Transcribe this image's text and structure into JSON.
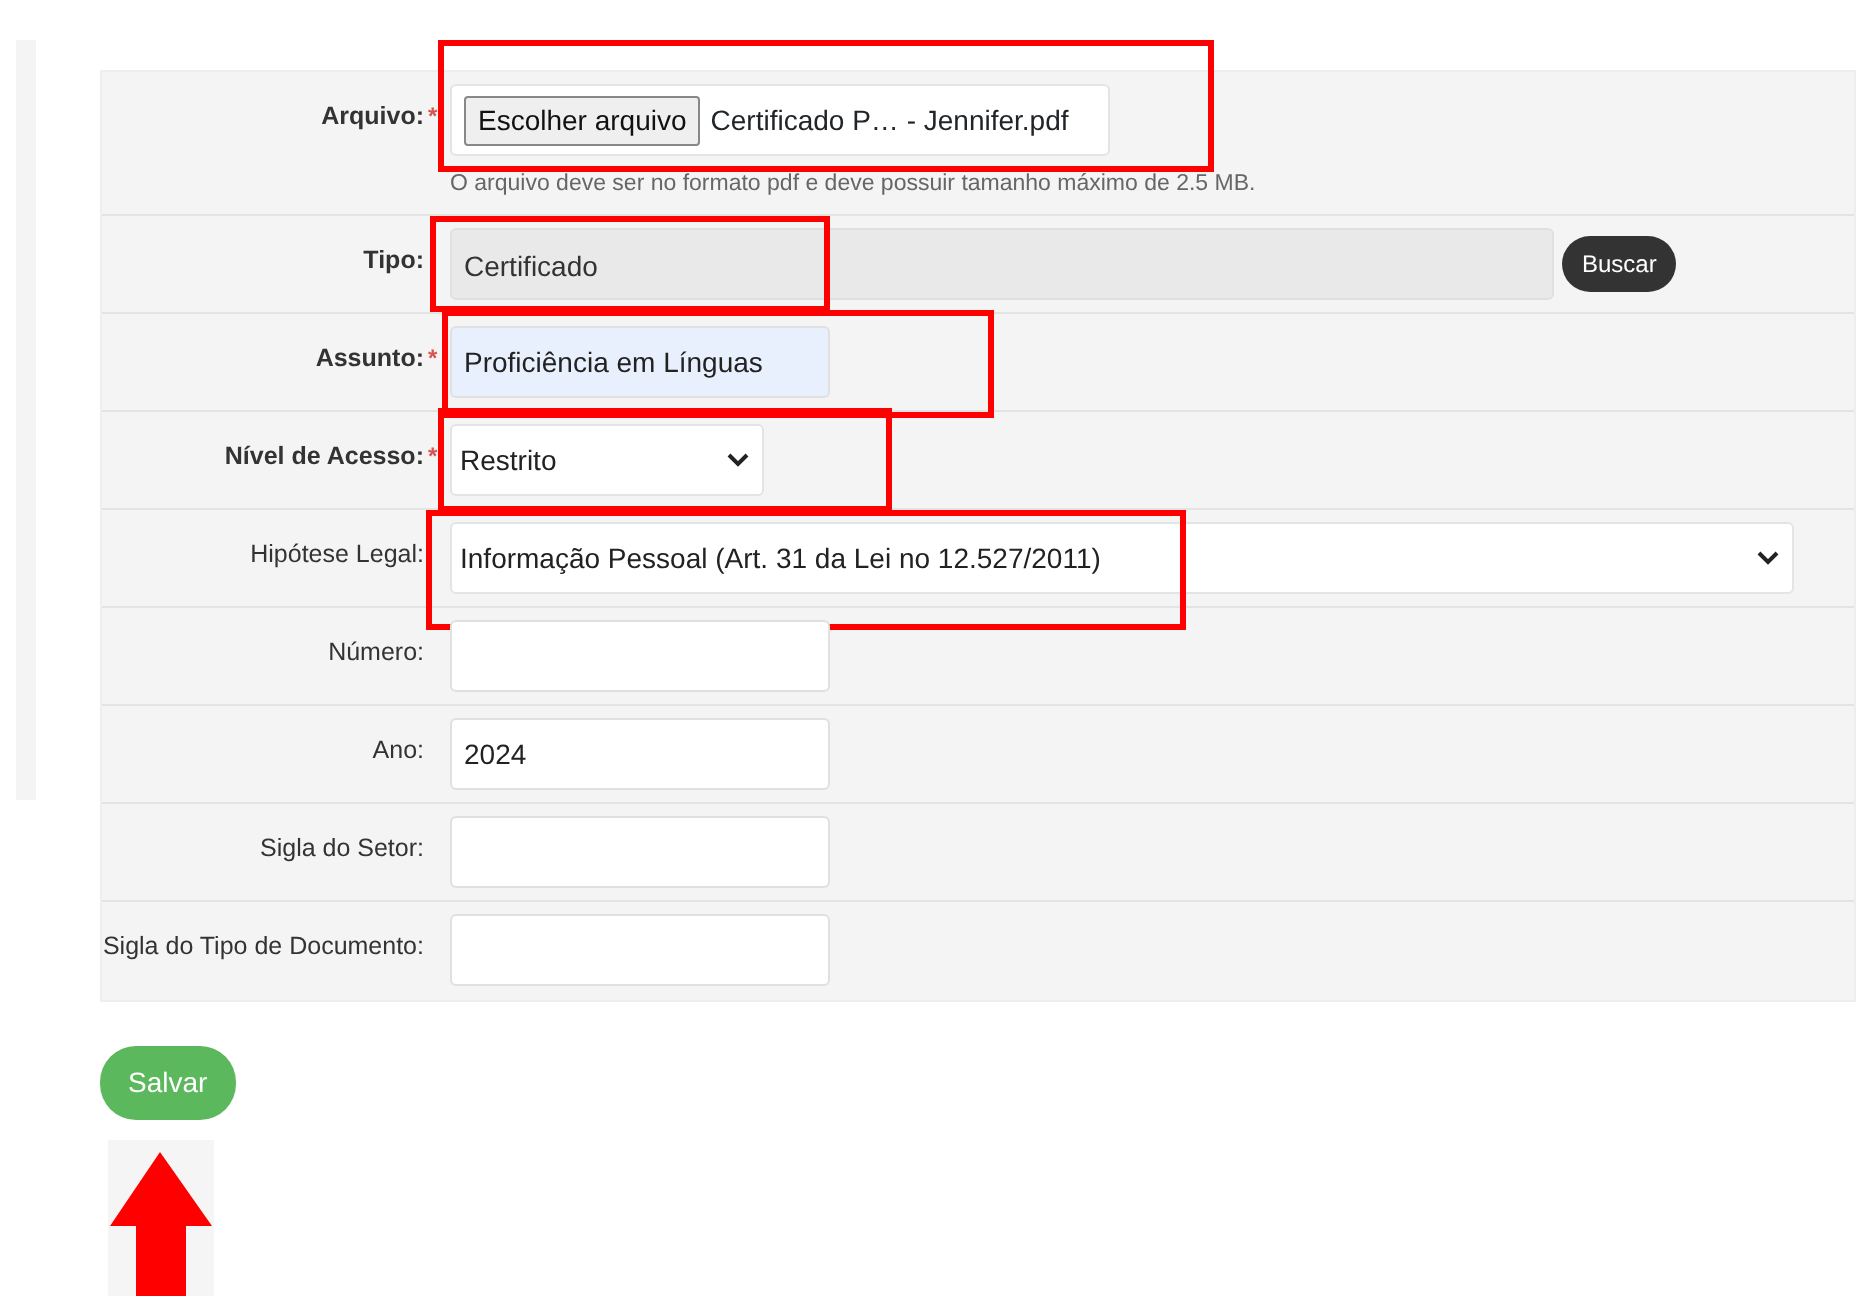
{
  "fields": [
    {
      "label": "Arquivo:",
      "kind": "file",
      "required_mark": "*",
      "bold": true,
      "annotated": true,
      "button": "Escolher arquivo",
      "value": "Certificado P… - Jennifer.pdf",
      "help": "O arquivo deve ser no formato pdf e deve possuir tamanho máximo de 2.5 MB."
    },
    {
      "label": "Tipo:",
      "kind": "lookup",
      "bold": true,
      "annotated": true,
      "value": "Certificado",
      "button": "Buscar"
    },
    {
      "label": "Assunto:",
      "kind": "text",
      "required_mark": "*",
      "bold": true,
      "annotated": true,
      "autofilled": true,
      "value": "Proficiência em Línguas"
    },
    {
      "label": "Nível de Acesso:",
      "kind": "select",
      "required_mark": "*",
      "bold": true,
      "annotated": true,
      "value": "Restrito"
    },
    {
      "label": "Hipótese Legal:",
      "kind": "wideselect",
      "bold": false,
      "annotated": true,
      "value": "Informação Pessoal (Art. 31 da Lei no 12.527/2011)"
    },
    {
      "label": "Número:",
      "kind": "text",
      "bold": false,
      "annotated": false,
      "autofilled": false
    },
    {
      "label": "Ano:",
      "kind": "text",
      "bold": false,
      "annotated": false,
      "autofilled": false,
      "value": "2024"
    },
    {
      "label": "Sigla do Setor:",
      "kind": "text",
      "bold": false,
      "annotated": false,
      "autofilled": false
    },
    {
      "label": "Sigla do Tipo de Documento:",
      "kind": "text",
      "bold": false,
      "annotated": false,
      "autofilled": false
    }
  ],
  "save_button": {
    "label": "Salvar",
    "arrow": true
  }
}
